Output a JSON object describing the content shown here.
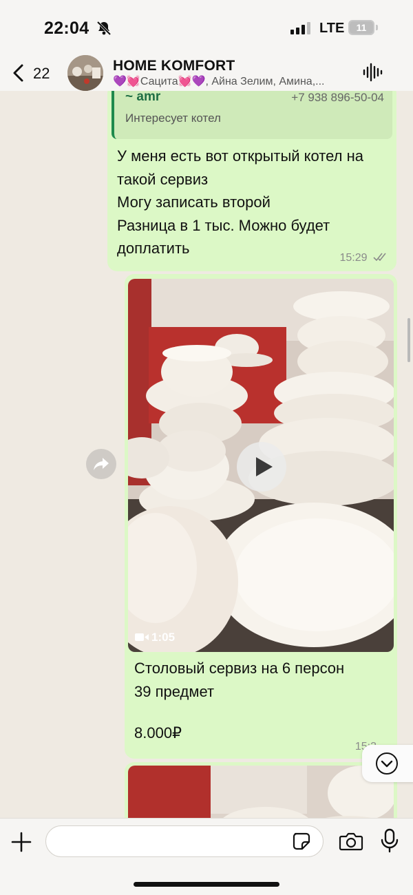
{
  "status_bar": {
    "time": "22:04",
    "network": "LTE",
    "battery": "11",
    "battery_color": "#e53935"
  },
  "header": {
    "back_count": "22",
    "title": "HOME KOMFORT",
    "subtitle": "💜💓Сацита💓💜, Айна Зелим, Амина,..."
  },
  "messages": {
    "m1": {
      "quote_author": "~ amr",
      "quote_phone": "+7 938 896-50-04",
      "quote_text": "Интересует котел",
      "lines": [
        "У меня есть вот открытый котел на",
        "такой сервиз",
        "Могу записать второй",
        "Разница в 1 тыс. Можно будет",
        "доплатить"
      ],
      "time": "15:29"
    },
    "m2": {
      "duration": "1:05",
      "caption_lines": [
        "Столовый сервиз на 6 персон",
        "39 предмет"
      ],
      "price": "8.000₽",
      "time": "15:3"
    }
  },
  "input": {
    "placeholder": "",
    "value": ""
  },
  "colors": {
    "bubble_outgoing": "#dcf8c6",
    "chat_background": "#efeae2",
    "quote_accent": "#1f8a4c"
  }
}
